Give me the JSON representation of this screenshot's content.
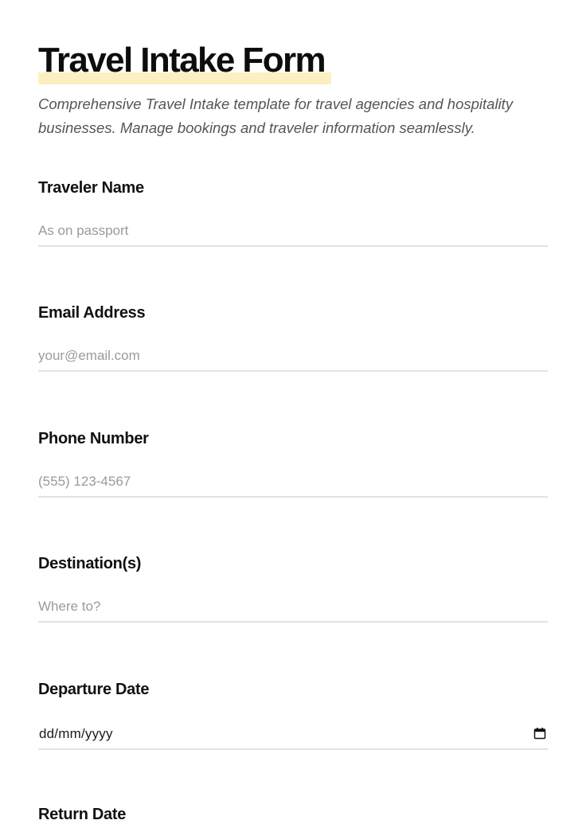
{
  "form": {
    "title": "Travel Intake Form",
    "subtitle": "Comprehensive Travel Intake template for travel agencies and hospitality businesses. Manage bookings and traveler information seamlessly.",
    "highlight_color": "#fdefc2"
  },
  "fields": [
    {
      "label": "Traveler Name",
      "placeholder": "As on passport",
      "value": ""
    },
    {
      "label": "Email Address",
      "placeholder": "your@email.com",
      "value": ""
    },
    {
      "label": "Phone Number",
      "placeholder": "(555) 123-4567",
      "value": ""
    },
    {
      "label": "Destination(s)",
      "placeholder": "Where to?",
      "value": ""
    },
    {
      "label": "Departure Date",
      "display_format": "dd/mm/yyyy",
      "icon": "calendar-icon"
    },
    {
      "label": "Return Date"
    }
  ]
}
